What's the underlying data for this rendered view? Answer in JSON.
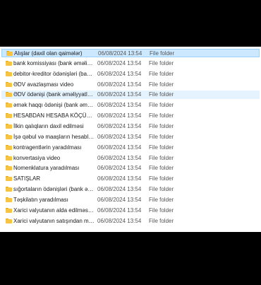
{
  "file_list": {
    "rows": [
      {
        "name": "Alışlar (daxil olan qaimələr)",
        "date": "06/08/2024 13:54",
        "type": "File folder",
        "state": "selected"
      },
      {
        "name": "bank komissiyası  (bank əməliyyatları)",
        "date": "06/08/2024 13:54",
        "type": "File folder",
        "state": ""
      },
      {
        "name": "debitor-kreditor ödənişləri (bank əməliyyatları)",
        "date": "06/08/2024 13:54",
        "type": "File folder",
        "state": ""
      },
      {
        "name": "ƏDV avazlaşması video",
        "date": "06/08/2024 13:54",
        "type": "File folder",
        "state": ""
      },
      {
        "name": "ƏDV ödənişi  (bank əməliyyatları)",
        "date": "06/08/2024 13:54",
        "type": "File folder",
        "state": "hovered"
      },
      {
        "name": "əmək haqqı ödənişi  (bank əməliyyatları)",
        "date": "06/08/2024 13:54",
        "type": "File folder",
        "state": ""
      },
      {
        "name": "HESABDAN HESABA KÖÇÜRMƏLƏR  (bank əməliyyatları)",
        "date": "06/08/2024 13:54",
        "type": "File folder",
        "state": ""
      },
      {
        "name": "İlkin qalıqların daxil edilməsi",
        "date": "06/08/2024 13:54",
        "type": "File folder",
        "state": ""
      },
      {
        "name": "İşə qəbul və maaşların hesablanması",
        "date": "06/08/2024 13:54",
        "type": "File folder",
        "state": ""
      },
      {
        "name": "kontragentlərin yaradılması",
        "date": "06/08/2024 13:54",
        "type": "File folder",
        "state": ""
      },
      {
        "name": "konvertasiya video",
        "date": "06/08/2024 13:54",
        "type": "File folder",
        "state": ""
      },
      {
        "name": "Nomenklatura yaradılması",
        "date": "06/08/2024 13:54",
        "type": "File folder",
        "state": ""
      },
      {
        "name": "SATIŞLAR",
        "date": "06/08/2024 13:54",
        "type": "File folder",
        "state": ""
      },
      {
        "name": "sığortaların ödənişləri (bank əməliyyatları)",
        "date": "06/08/2024 13:54",
        "type": "File folder",
        "state": ""
      },
      {
        "name": "Təşkilatın yaradılması",
        "date": "06/08/2024 13:54",
        "type": "File folder",
        "state": ""
      },
      {
        "name": "Xarici valyutanın alda edilməsi (bank əməliyyatları)",
        "date": "06/08/2024 13:54",
        "type": "File folder",
        "state": ""
      },
      {
        "name": "Xarici valyutanın satışından mədaxil (bank əməliyyatları)",
        "date": "06/08/2024 13:54",
        "type": "File folder",
        "state": ""
      }
    ]
  },
  "colors": {
    "folder": "#f6c342",
    "selected_bg": "#cce8ff",
    "hover_bg": "#e5f3ff"
  },
  "icons": {
    "folder": "folder-icon"
  }
}
